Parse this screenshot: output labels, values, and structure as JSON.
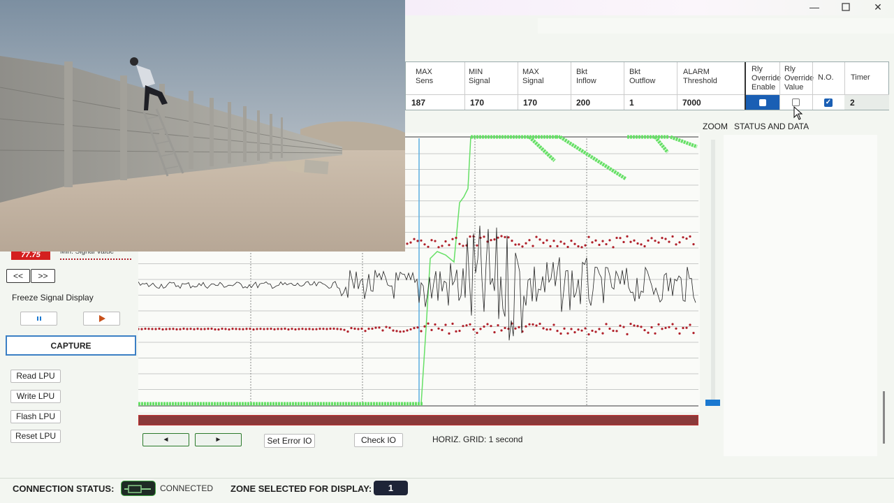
{
  "window": {
    "minimize_icon": "minimize-icon",
    "maximize_icon": "maximize-icon",
    "close_icon": "close-icon"
  },
  "table": {
    "headers": [
      "MAX\nSens",
      "MIN\nSignal",
      "MAX\nSignal",
      "Bkt\nInflow",
      "Bkt\nOutflow",
      "ALARM\nThreshold",
      "Rly\nOverride\nEnable",
      "Rly\nOverride\nValue",
      "N.O.",
      "Timer"
    ],
    "values": [
      "187",
      "170",
      "170",
      "200",
      "1",
      "7000",
      "",
      "",
      "",
      "2"
    ],
    "rly_override_enable": true,
    "rly_override_value": false,
    "no_checked": true
  },
  "panel": {
    "zoom_label": "ZOOM",
    "status_label": "STATUS AND DATA"
  },
  "left": {
    "min_value_badge": "77.75",
    "min_value_label": "Min. Signal Value",
    "prev_label": "<<",
    "next_label": ">>",
    "freeze_label": "Freeze Signal Display",
    "pause_icon": "pause-icon",
    "play_icon": "play-icon",
    "capture_label": "CAPTURE",
    "read_label": "Read LPU",
    "write_label": "Write LPU",
    "flash_label": "Flash LPU",
    "reset_label": "Reset LPU"
  },
  "bottom": {
    "scroll_left": "◄",
    "scroll_right": "►",
    "set_error_label": "Set Error IO",
    "check_io_label": "Check IO",
    "horiz_grid": "HORIZ. GRID: 1 second"
  },
  "status": {
    "connection_label": "CONNECTION STATUS:",
    "connection_value": "CONNECTED",
    "zone_label": "ZONE SELECTED FOR DISPLAY:",
    "zone_value": "1"
  },
  "colors": {
    "accent": "#1a5fb4",
    "green_signal": "#66e066",
    "red_threshold": "#b0202a",
    "error_bar": "#8a3a3a",
    "zone_badge": "#1e2437"
  }
}
